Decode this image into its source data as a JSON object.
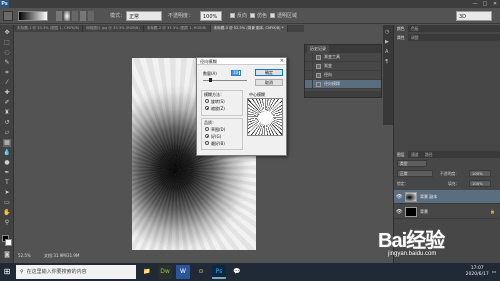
{
  "app": {
    "logo": "Ps",
    "window_buttons": [
      "—",
      "□",
      "✕"
    ]
  },
  "options_bar": {
    "mode_label": "模式：",
    "mode_value": "正常",
    "opacity_label": "不透明度：",
    "opacity_value": "100%",
    "reverse_label": "反向",
    "dither_label": "仿色",
    "transparency_label": "透明区域",
    "workspace_value": "3D"
  },
  "tabs": [
    {
      "label": "未标题-1 @ 33.3% (图层 1, CMYK/8)"
    },
    {
      "label": "网络图片.jpg @ 33.3% (RGB/8)"
    },
    {
      "label": "未标题-2 @ 33.3% (图层 1, RGB/8)"
    },
    {
      "label": "未标题-3 @ 52.5% (背景 副本, CMYK/8) *",
      "active": true
    }
  ],
  "dialog": {
    "title": "径向模糊",
    "close": "×",
    "amount_label": "数量(A)",
    "amount_value": "10",
    "ok": "确定",
    "cancel": "取消",
    "method_group": "模糊方法：",
    "method_options": [
      "旋转(S)",
      "缩放(Z)"
    ],
    "method_selected": 1,
    "center_label": "中心模糊",
    "quality_group": "品质：",
    "quality_options": [
      "草图(D)",
      "好(G)",
      "最好(B)"
    ],
    "quality_selected": 1
  },
  "history_panel": {
    "tab": "历史记录",
    "items": [
      {
        "label": "渐变工具"
      },
      {
        "label": "渐变"
      },
      {
        "label": "径向"
      },
      {
        "label": "径向模糊",
        "active": true
      }
    ]
  },
  "right_panels": {
    "top_tabs": [
      "颜色",
      "色板"
    ],
    "props_tabs": [
      "属性",
      "调整"
    ],
    "layers_tabs": [
      "图层",
      "通道",
      "路径"
    ],
    "kind_label": "类型",
    "blend_mode": "正常",
    "opacity_label": "不透明度：",
    "opacity_value": "100%",
    "lock_label": "锁定：",
    "fill_label": "填充：",
    "fill_value": "100%",
    "layers": [
      {
        "name": "背景 副本",
        "active": true
      },
      {
        "name": "背景",
        "locked": true
      }
    ]
  },
  "status": {
    "zoom": "52.5%",
    "doc_size": "文档:31.9M/31.9M"
  },
  "taskbar": {
    "search_placeholder": "在这里输入你要搜索的内容",
    "apps": [
      "📁",
      "Dw",
      "W",
      "⊙",
      "Ps",
      "💬"
    ],
    "time": "17:07",
    "date": "2020/6/17"
  },
  "watermark": {
    "brand": "Bai经验",
    "url": "jingyan.baidu.com"
  },
  "colors": {
    "ps_blue": "#2f5376",
    "selection": "#5a6e80",
    "taskbar": "#1f2a36"
  }
}
